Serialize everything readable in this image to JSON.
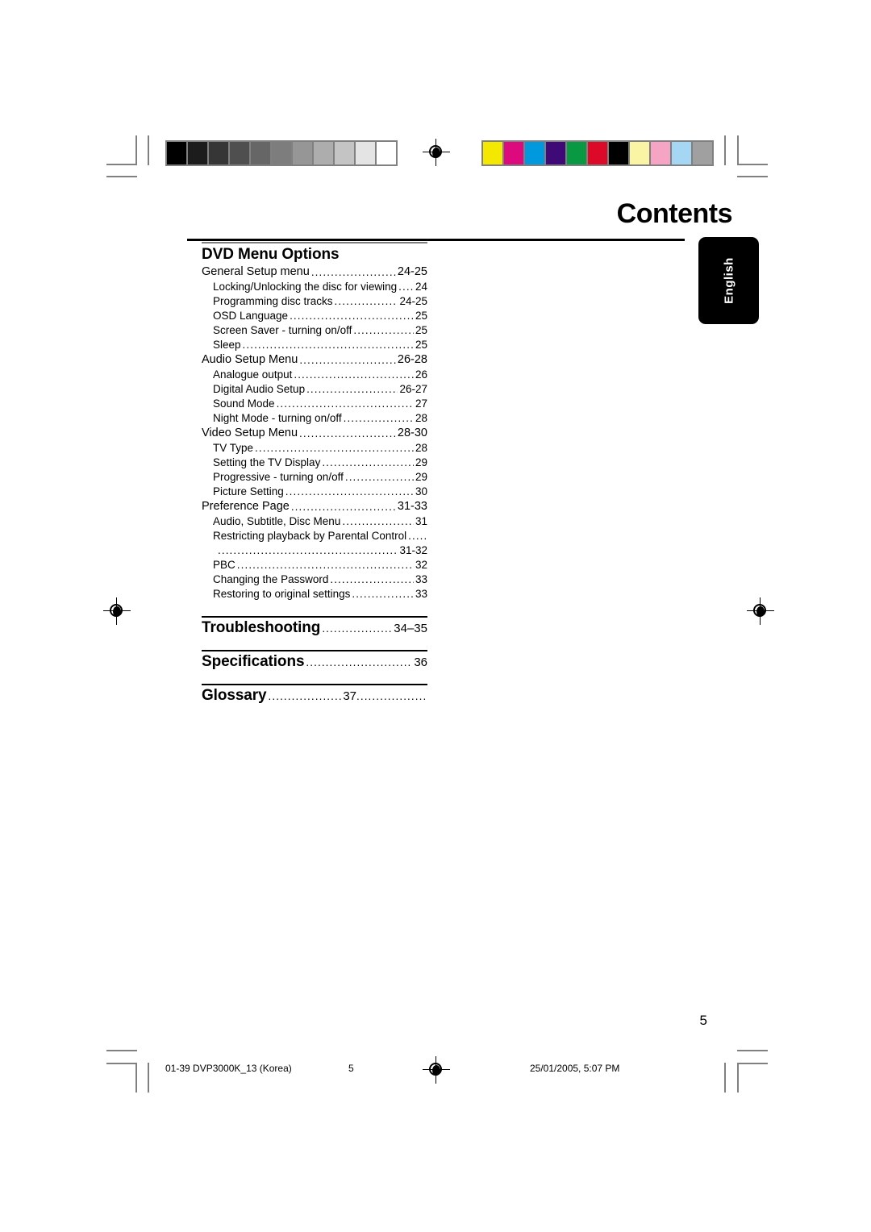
{
  "page": {
    "title": "Contents",
    "folio": "5",
    "language_tab": "English"
  },
  "toc": {
    "sections": [
      {
        "heading": "DVD Menu Options",
        "entries": [
          {
            "level": 1,
            "label": "General Setup menu",
            "page": "24-25"
          },
          {
            "level": 2,
            "label": "Locking/Unlocking the disc for viewing",
            "page": "24"
          },
          {
            "level": 2,
            "label": "Programming disc tracks",
            "page": "24-25"
          },
          {
            "level": 2,
            "label": "OSD Language",
            "page": "25"
          },
          {
            "level": 2,
            "label": "Screen Saver - turning on/off",
            "page": "25"
          },
          {
            "level": 2,
            "label": "Sleep",
            "page": "25"
          },
          {
            "level": 1,
            "label": "Audio Setup Menu",
            "page": "26-28"
          },
          {
            "level": 2,
            "label": "Analogue output",
            "page": "26"
          },
          {
            "level": 2,
            "label": "Digital Audio Setup",
            "page": "26-27"
          },
          {
            "level": 2,
            "label": "Sound Mode",
            "page": "27"
          },
          {
            "level": 2,
            "label": "Night Mode - turning on/off",
            "page": "28"
          },
          {
            "level": 1,
            "label": "Video Setup Menu",
            "page": "28-30"
          },
          {
            "level": 2,
            "label": "TV Type",
            "page": "28"
          },
          {
            "level": 2,
            "label": "Setting the TV Display",
            "page": "29"
          },
          {
            "level": 2,
            "label": "Progressive - turning on/off",
            "page": "29"
          },
          {
            "level": 2,
            "label": "Picture Setting",
            "page": "30"
          },
          {
            "level": 1,
            "label": "Preference Page",
            "page": "31-33"
          },
          {
            "level": 2,
            "label": "Audio, Subtitle, Disc Menu",
            "page": "31"
          },
          {
            "level": 2,
            "label": "Restricting playback by Parental Control",
            "page": ""
          },
          {
            "level": 3,
            "label": "",
            "page": "31-32"
          },
          {
            "level": 2,
            "label": "PBC",
            "page": "32"
          },
          {
            "level": 2,
            "label": "Changing the Password",
            "page": "33"
          },
          {
            "level": 2,
            "label": "Restoring to original settings",
            "page": "33"
          }
        ]
      }
    ],
    "big_entries": [
      {
        "label": "Troubleshooting",
        "page": "34–35",
        "trailing_dots": false
      },
      {
        "label": "Specifications",
        "page": "36",
        "trailing_dots": false
      },
      {
        "label": "Glossary",
        "page": "37",
        "trailing_dots": true
      }
    ]
  },
  "prepress": {
    "footer_left": "01-39 DVP3000K_13 (Korea)",
    "footer_center": "5",
    "footer_right": "25/01/2005, 5:07 PM",
    "grayscale_bar": [
      "#000000",
      "#1c1c1c",
      "#363636",
      "#4f4f4f",
      "#666666",
      "#7d7d7d",
      "#969696",
      "#adadad",
      "#c4c4c4",
      "#e4e4e4",
      "#ffffff"
    ],
    "color_bar": [
      "#f5e800",
      "#dc0a7d",
      "#0099dd",
      "#3f0a78",
      "#0a9943",
      "#dc0a28",
      "#000000",
      "#faf5a5",
      "#f5a5c3",
      "#a5d7f5",
      "#a0a0a0"
    ]
  }
}
